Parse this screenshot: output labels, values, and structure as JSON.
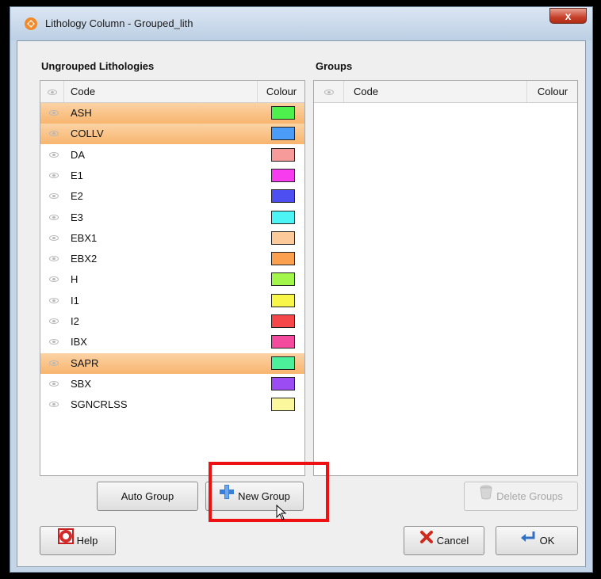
{
  "window": {
    "title": "Lithology Column - Grouped_lith",
    "close_label": "x"
  },
  "ungrouped": {
    "label": "Ungrouped Lithologies",
    "columns": {
      "code": "Code",
      "colour": "Colour"
    },
    "rows": [
      {
        "code": "ASH",
        "color": "#4ef04e",
        "selected": true
      },
      {
        "code": "COLLV",
        "color": "#4a9cf8",
        "selected": true
      },
      {
        "code": "DA",
        "color": "#f79a9a",
        "selected": false
      },
      {
        "code": "E1",
        "color": "#f73cf0",
        "selected": false
      },
      {
        "code": "E2",
        "color": "#4d4ff0",
        "selected": false
      },
      {
        "code": "E3",
        "color": "#4cf4f6",
        "selected": false
      },
      {
        "code": "EBX1",
        "color": "#fbc99a",
        "selected": false
      },
      {
        "code": "EBX2",
        "color": "#fba04f",
        "selected": false
      },
      {
        "code": "H",
        "color": "#a2f54b",
        "selected": false
      },
      {
        "code": "I1",
        "color": "#f9f64a",
        "selected": false
      },
      {
        "code": "I2",
        "color": "#f5474a",
        "selected": false
      },
      {
        "code": "IBX",
        "color": "#f54b9e",
        "selected": false
      },
      {
        "code": "SAPR",
        "color": "#4cf09a",
        "selected": true
      },
      {
        "code": "SBX",
        "color": "#9c4cf3",
        "selected": false
      },
      {
        "code": "SGNCRLSS",
        "color": "#fbf79c",
        "selected": false
      }
    ]
  },
  "groups": {
    "label": "Groups",
    "columns": {
      "code": "Code",
      "colour": "Colour"
    }
  },
  "buttons": {
    "auto_group": "Auto Group",
    "new_group": "New Group",
    "delete_groups": "Delete Groups",
    "help": "Help",
    "cancel": "Cancel",
    "ok": "OK"
  }
}
